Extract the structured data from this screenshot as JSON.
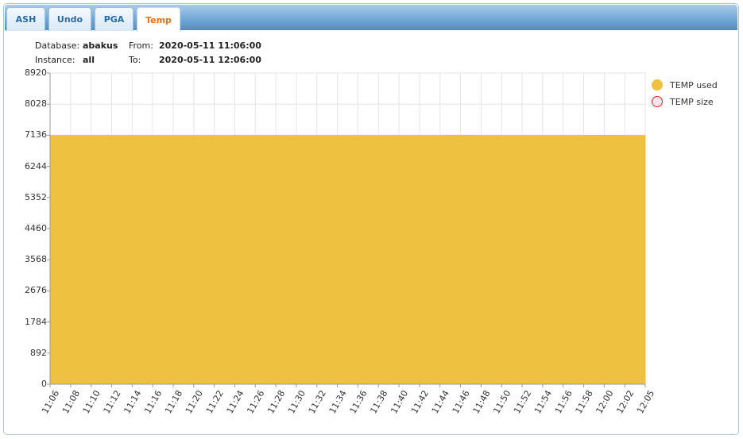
{
  "tabs": [
    {
      "label": "ASH",
      "active": false
    },
    {
      "label": "Undo",
      "active": false
    },
    {
      "label": "PGA",
      "active": false
    },
    {
      "label": "Temp",
      "active": true
    }
  ],
  "info": {
    "database_label": "Database:",
    "database_value": "abakus",
    "instance_label": "Instance:",
    "instance_value": "all",
    "from_label": "From:",
    "from_value": "2020-05-11 11:06:00",
    "to_label": "To:",
    "to_value": "2020-05-11 12:06:00"
  },
  "colors": {
    "temp_used": "#eec140",
    "temp_size_fill": "#e9e9e9",
    "temp_size_border": "#d9262a",
    "active_tab": "#e0731a"
  },
  "chart_data": {
    "type": "area",
    "ylim": [
      0,
      8920
    ],
    "y_ticks": [
      "0",
      "892",
      "1784",
      "2676",
      "3568",
      "4460",
      "5352",
      "6244",
      "7136",
      "8028",
      "8920"
    ],
    "x": [
      "11:06",
      "11:08",
      "11:10",
      "11:12",
      "11:14",
      "11:16",
      "11:18",
      "11:20",
      "11:22",
      "11:24",
      "11:26",
      "11:28",
      "11:30",
      "11:32",
      "11:34",
      "11:36",
      "11:38",
      "11:40",
      "11:42",
      "11:44",
      "11:46",
      "11:48",
      "11:50",
      "11:52",
      "11:54",
      "11:56",
      "11:58",
      "12:00",
      "12:02",
      "12:05"
    ],
    "series": [
      {
        "name": "TEMP used",
        "values": [
          7130,
          7130,
          7130,
          7130,
          7130,
          7130,
          7130,
          7130,
          7130,
          7130,
          7130,
          7130,
          7130,
          7130,
          7130,
          7130,
          7130,
          7130,
          7130,
          7130,
          7140,
          7130,
          7130,
          7130,
          7130,
          7130,
          7130,
          7135,
          7130,
          7130
        ]
      },
      {
        "name": "TEMP size",
        "values": []
      }
    ],
    "grid": true,
    "legend": "right"
  }
}
